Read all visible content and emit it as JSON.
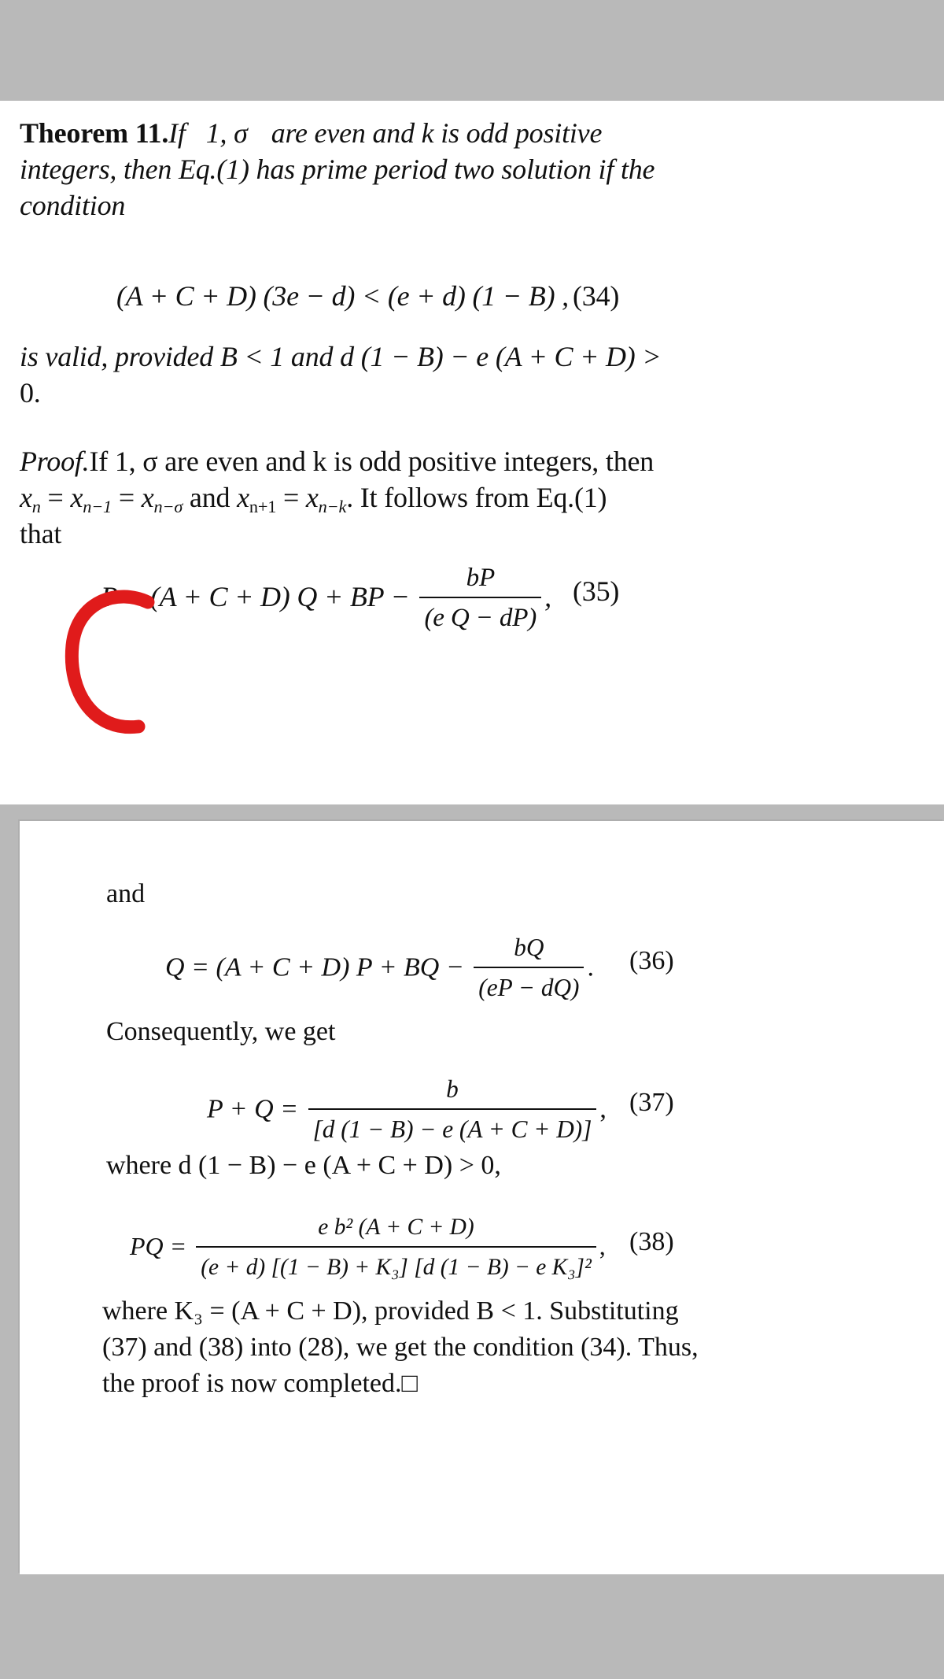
{
  "meta": {
    "background_color": "#b9b9b9",
    "page_color": "#ffffff",
    "text_color": "#111111",
    "annotation_color": "#e01b1b"
  },
  "page_top": {
    "theorem_label": "Theorem 11.",
    "theorem_statement_line1": "If",
    "theorem_vars": "1, σ",
    "theorem_statement_line1b": "are even and k is odd positive",
    "theorem_statement_line2": "integers, then Eq.(1) has prime period two solution if the",
    "theorem_statement_line3": "condition",
    "eq34": {
      "lhs": "(A + C + D) (3e − d) < (e + d) (1 − B) ,",
      "number": "(34)"
    },
    "valid_line1": "is valid, provided B < 1 and  d (1 − B) − e (A + C + D) >",
    "valid_line2": "0.",
    "proof_label": "Proof.",
    "proof_line1": "If  1, σ  are even and k is odd positive integers, then",
    "proof_line2_a": "x",
    "proof_line2": "xₙ = xₙ₋₁ = xₙ₋σ and xₙ₊₁ = xₙ₋ₖ. It follows from Eq.(1)",
    "proof_line3": "that",
    "eq35": {
      "lhs": "P = (A + C + D) Q + BP −",
      "num": "bP",
      "den": "(e Q −  dP)",
      "tail": ",",
      "number": "(35)"
    },
    "annotation": "red-c-mark"
  },
  "page_bottom": {
    "and_label": "and",
    "eq36": {
      "lhs": "Q = (A + C + D) P + BQ −",
      "num": "bQ",
      "den": "(eP −  dQ)",
      "tail": ".",
      "number": "(36)"
    },
    "consequently": "Consequently, we get",
    "eq37": {
      "lhs": "P + Q =",
      "num": "b",
      "den": "[d (1 − B) − e (A + C + D)]",
      "tail": ",",
      "number": "(37)"
    },
    "where_line": "where d (1 − B) − e (A + C + D) > 0,",
    "eq38": {
      "lhs": "PQ =",
      "num": "e b² (A + C + D)",
      "den": "(e + d) [(1 − B) + K₃] [d (1 − B) − e K₃]²",
      "tail": ",",
      "number": "(38)"
    },
    "closing_line1": "where K₃ = (A + C + D), provided B < 1. Substituting",
    "closing_line2": "(37) and (38) into (28), we get the condition (34). Thus,",
    "closing_line3": "the proof is now completed.□"
  }
}
